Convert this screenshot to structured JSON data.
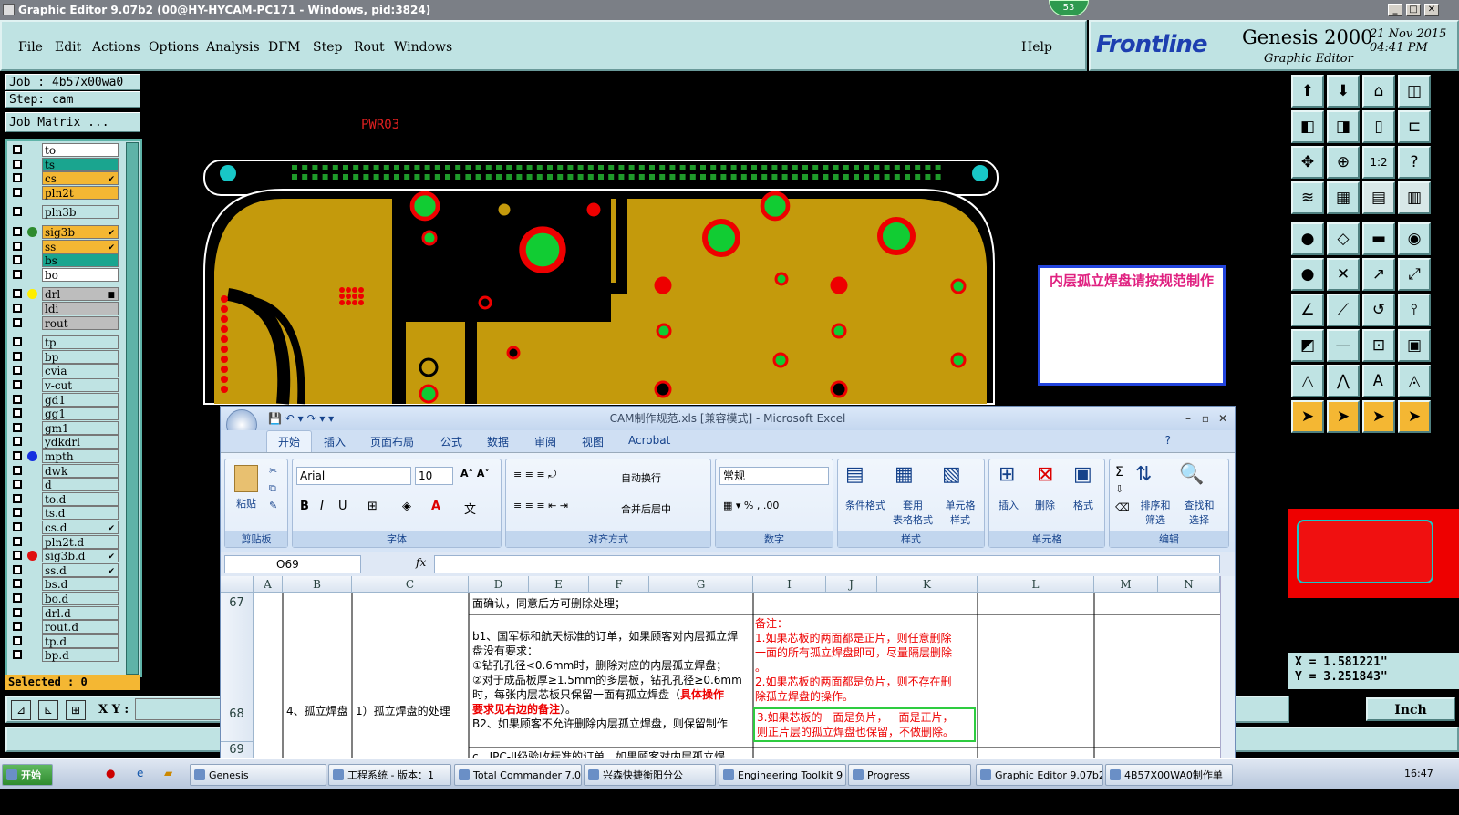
{
  "window": {
    "title": "Graphic Editor 9.07b2 (00@HY-HYCAM-PC171 - Windows, pid:3824)",
    "badge": "53",
    "min": "_",
    "max": "□",
    "close": "✕"
  },
  "menu": {
    "items": [
      "File",
      "Edit",
      "Actions",
      "Options",
      "Analysis",
      "DFM",
      "Step",
      "Rout",
      "Windows"
    ],
    "help": "Help"
  },
  "brand": {
    "logo": "Frontline",
    "product": "Genesis 2000",
    "subtitle": "Graphic Editor",
    "date": "21 Nov 2015",
    "time": "04:41 PM"
  },
  "job": {
    "job_label": "Job : 4b57x00wa0",
    "step_label": "Step: cam",
    "matrix_button": "Job Matrix ..."
  },
  "layers": [
    {
      "name": "to",
      "bg": "#ffffff",
      "dot": "",
      "flag": ""
    },
    {
      "name": "ts",
      "bg": "#1aa58f",
      "dot": "",
      "flag": ""
    },
    {
      "name": "cs",
      "bg": "#f4b733",
      "dot": "",
      "flag": "✔"
    },
    {
      "name": "pln2t",
      "bg": "#f4b733",
      "dot": "",
      "flag": ""
    },
    {
      "name": "pln3b",
      "bg": "#bfe3e3",
      "dot": "",
      "flag": ""
    },
    {
      "name": "sig3b",
      "bg": "#f4b733",
      "dot": "#2e8b2e",
      "flag": "✔"
    },
    {
      "name": "ss",
      "bg": "#f4b733",
      "dot": "",
      "flag": "✔"
    },
    {
      "name": "bs",
      "bg": "#1aa58f",
      "dot": "",
      "flag": ""
    },
    {
      "name": "bo",
      "bg": "#ffffff",
      "dot": "",
      "flag": ""
    },
    {
      "name": "drl",
      "bg": "#bdbdbd",
      "dot": "#ffee00",
      "flag": "■"
    },
    {
      "name": "ldi",
      "bg": "#bdbdbd",
      "dot": "",
      "flag": ""
    },
    {
      "name": "rout",
      "bg": "#bdbdbd",
      "dot": "",
      "flag": ""
    },
    {
      "name": "tp",
      "bg": "#bfe3e3",
      "dot": "",
      "flag": ""
    },
    {
      "name": "bp",
      "bg": "#bfe3e3",
      "dot": "",
      "flag": ""
    },
    {
      "name": "cvia",
      "bg": "#bfe3e3",
      "dot": "",
      "flag": ""
    },
    {
      "name": "v-cut",
      "bg": "#bfe3e3",
      "dot": "",
      "flag": ""
    },
    {
      "name": "gd1",
      "bg": "#bfe3e3",
      "dot": "",
      "flag": ""
    },
    {
      "name": "gg1",
      "bg": "#bfe3e3",
      "dot": "",
      "flag": ""
    },
    {
      "name": "gm1",
      "bg": "#bfe3e3",
      "dot": "",
      "flag": ""
    },
    {
      "name": "ydkdrl",
      "bg": "#bfe3e3",
      "dot": "",
      "flag": ""
    },
    {
      "name": "mpth",
      "bg": "#bfe3e3",
      "dot": "#1530e0",
      "flag": ""
    },
    {
      "name": "dwk",
      "bg": "#bfe3e3",
      "dot": "",
      "flag": ""
    },
    {
      "name": "d",
      "bg": "#bfe3e3",
      "dot": "",
      "flag": ""
    },
    {
      "name": "to.d",
      "bg": "#bfe3e3",
      "dot": "",
      "flag": ""
    },
    {
      "name": "ts.d",
      "bg": "#bfe3e3",
      "dot": "",
      "flag": ""
    },
    {
      "name": "cs.d",
      "bg": "#bfe3e3",
      "dot": "",
      "flag": "✔"
    },
    {
      "name": "pln2t.d",
      "bg": "#bfe3e3",
      "dot": "",
      "flag": ""
    },
    {
      "name": "sig3b.d",
      "bg": "#bfe3e3",
      "dot": "#e01010",
      "flag": "✔"
    },
    {
      "name": "ss.d",
      "bg": "#bfe3e3",
      "dot": "",
      "flag": "✔"
    },
    {
      "name": "bs.d",
      "bg": "#bfe3e3",
      "dot": "",
      "flag": ""
    },
    {
      "name": "bo.d",
      "bg": "#bfe3e3",
      "dot": "",
      "flag": ""
    },
    {
      "name": "drl.d",
      "bg": "#bfe3e3",
      "dot": "",
      "flag": ""
    },
    {
      "name": "rout.d",
      "bg": "#bfe3e3",
      "dot": "",
      "flag": ""
    },
    {
      "name": "tp.d",
      "bg": "#bfe3e3",
      "dot": "",
      "flag": ""
    },
    {
      "name": "bp.d",
      "bg": "#bfe3e3",
      "dot": "",
      "flag": ""
    }
  ],
  "selected": "Selected : 0",
  "canvas": {
    "label": "PWR03",
    "note": "内层孤立焊盘请按规范制作"
  },
  "coords": {
    "x": "X = 1.581221\"",
    "y": "Y = 3.251843\""
  },
  "xy_label": "X Y :",
  "units": "Inch",
  "excel": {
    "title": "CAM制作规范.xls  [兼容模式] - Microsoft Excel",
    "tabs": [
      "开始",
      "插入",
      "页面布局",
      "公式",
      "数据",
      "审阅",
      "视图",
      "Acrobat"
    ],
    "ribbon": {
      "paste": "粘贴",
      "clipboard": "剪贴板",
      "font_name": "Arial",
      "font_size": "10",
      "font_group": "字体",
      "wrap": "自动换行",
      "merge": "合并后居中",
      "align_group": "对齐方式",
      "number_format": "常规",
      "number_group": "数字",
      "cond_format": "条件格式",
      "table_format": "套用\n表格格式",
      "cell_style": "单元格\n样式",
      "style_group": "样式",
      "insert": "插入",
      "delete": "删除",
      "format": "格式",
      "cells_group": "单元格",
      "sort": "排序和\n筛选",
      "find": "查找和\n选择",
      "edit_group": "编辑"
    },
    "namebox": "O69",
    "fx": "fx",
    "columns": [
      "A",
      "B",
      "C",
      "D",
      "E",
      "F",
      "G",
      "I",
      "J",
      "K",
      "L",
      "M",
      "N"
    ],
    "rows": [
      "67",
      "68",
      "69"
    ],
    "cells": {
      "d67": "面确认，同意后方可删除处理；",
      "b69": "4、孤立焊盘",
      "c69": "1）孤立焊盘的处理",
      "d68a": "b1、国军标和航天标准的订单，如果顾客对内层孤立焊",
      "d68b": "盘没有要求：",
      "d68c": "①钻孔孔径<0.6mm时，删除对应的内层孤立焊盘；",
      "d68d": "②对于成品板厚≥1.5mm的多层板，钻孔孔径≥0.6mm",
      "d68e": "时，每张内层芯板只保留一面有孤立焊盘（",
      "d68f": "具体操作",
      "d68g": "要求见右边的备注",
      "d68h": "）。",
      "d68i": "B2、如果顾客不允许删除内层孤立焊盘，则保留制作",
      "d70": "c、IPC-II级验收标准的订单，如果顾客对内层孤立焊",
      "i_title": "备注：",
      "i1a": "1.如果芯板的两面都是正片，则任意删除",
      "i1b": "一面的所有孤立焊盘即可，尽量隔层删除",
      "i1c": "。",
      "i2a": "2.如果芯板的两面都是负片，则不存在删",
      "i2b": "除孤立焊盘的操作。",
      "i3a": "3.如果芯板的一面是负片，一面是正片，",
      "i3b": "则正片层的孤立焊盘也保留，不做删除。"
    }
  },
  "taskbar": [
    "开始",
    "Genesis",
    "工程系统 - 版本：1",
    "Total Commander 7.0",
    "兴森快捷衡阳分公",
    "Engineering Toolkit 9",
    "Progress",
    "Graphic Editor 9.07b2",
    "4B57X00WA0制作单",
    "16:47"
  ]
}
